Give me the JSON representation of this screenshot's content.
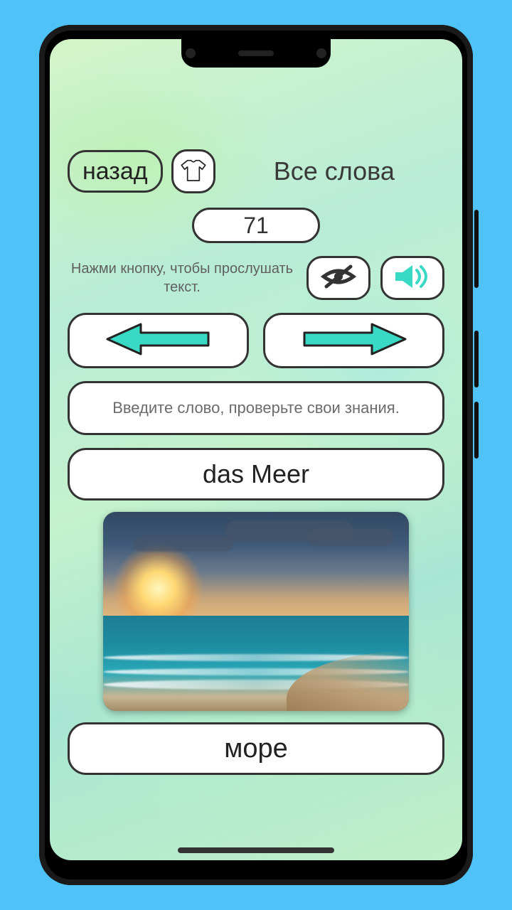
{
  "top": {
    "back_label": "назад",
    "title": "Все слова"
  },
  "counter": "71",
  "hint": "Нажми кнопку, чтобы прослушать текст.",
  "input_placeholder": "Введите слово, проверьте свои знания.",
  "word": "das Meer",
  "translation": "море",
  "colors": {
    "accent": "#3ad9c5"
  }
}
